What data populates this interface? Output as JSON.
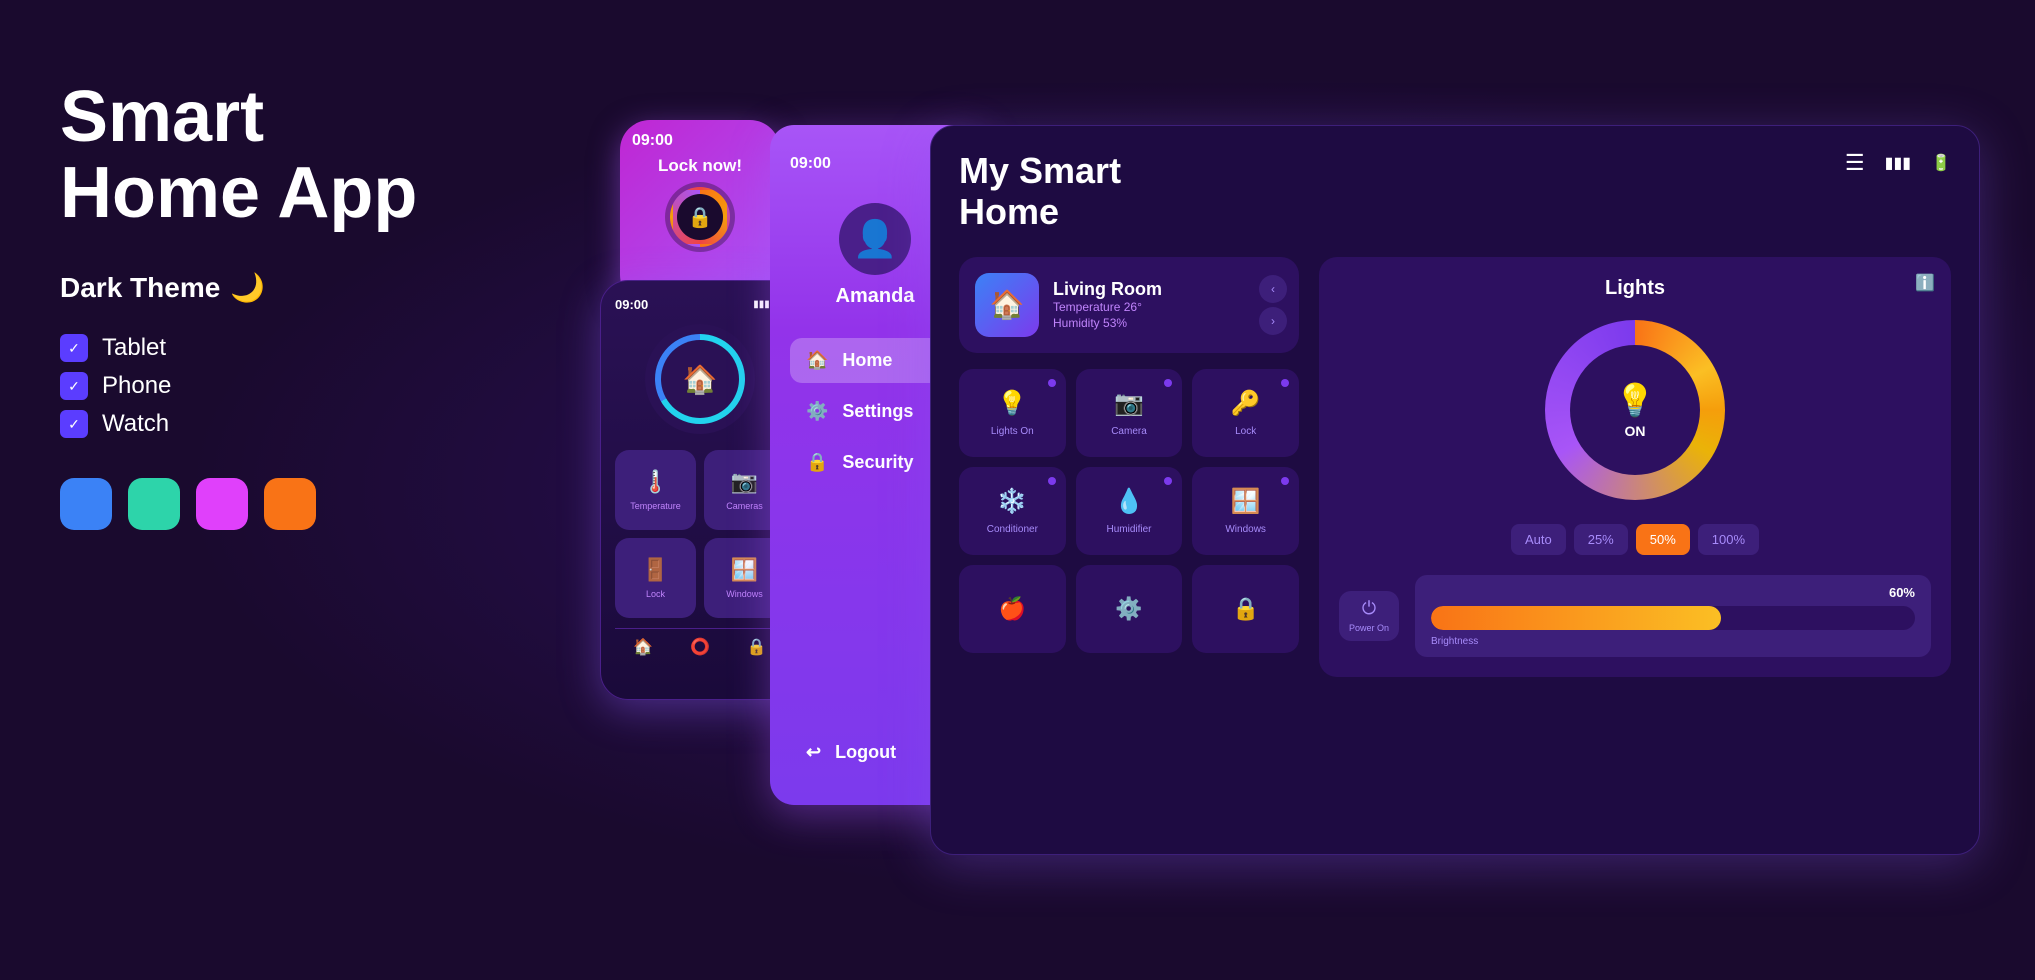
{
  "app": {
    "title_line1": "Smart",
    "title_line2": "Home App",
    "theme_label": "Dark Theme",
    "moon": "🌙",
    "devices": [
      {
        "name": "Tablet",
        "check": "✓"
      },
      {
        "name": "Phone",
        "check": "✓"
      },
      {
        "name": "Watch",
        "check": "✓"
      }
    ],
    "colors": [
      "#3b82f6",
      "#2dd4aa",
      "#e040fb",
      "#f97316"
    ]
  },
  "watch": {
    "time": "09:00",
    "label": "Lock now!",
    "icon": "🔒"
  },
  "phone": {
    "time": "09:00",
    "signal": "▮▮▮",
    "battery": "▮▮",
    "house_icon": "🏠",
    "grid_items": [
      {
        "icon": "🌡️",
        "label": "Temperature"
      },
      {
        "icon": "📷",
        "label": "Cameras"
      },
      {
        "icon": "🚪",
        "label": "Lock"
      },
      {
        "icon": "🪟",
        "label": "Windows"
      }
    ]
  },
  "sidebar": {
    "time": "09:00",
    "user_icon": "👤",
    "username": "Amanda",
    "nav_items": [
      {
        "label": "Home",
        "icon": "🏠",
        "active": true
      },
      {
        "label": "Settings",
        "icon": "⚙️",
        "active": false
      },
      {
        "label": "Security",
        "icon": "🔒",
        "active": false
      },
      {
        "label": "Logout",
        "icon": "↩",
        "active": false
      }
    ]
  },
  "tablet": {
    "title_line1": "My Smart",
    "title_line2": "Home",
    "menu_icon": "☰",
    "room": {
      "name": "Living Room",
      "icon": "🏠",
      "temperature_label": "Temperature",
      "temperature_value": "26°",
      "humidity_label": "Humidity",
      "humidity_value": "53%"
    },
    "devices": [
      {
        "icon": "💡",
        "label": "Lights On"
      },
      {
        "icon": "📷",
        "label": "Camera"
      },
      {
        "icon": "🔑",
        "label": "Lock"
      },
      {
        "icon": "❄️",
        "label": "Conditioner"
      },
      {
        "icon": "💧",
        "label": "Humidifier"
      },
      {
        "icon": "🪟",
        "label": "Windows"
      }
    ],
    "bottom_devices": [
      {
        "icon": "🍎"
      },
      {
        "icon": "⚙️"
      },
      {
        "icon": "🔒"
      }
    ],
    "lights": {
      "title": "Lights",
      "on_label": "ON",
      "brightness_options": [
        "Auto",
        "25%",
        "50%",
        "100%"
      ],
      "active_brightness": "50%",
      "power_label": "Power On",
      "brightness_label": "Brightness",
      "brightness_pct": "60%"
    }
  }
}
